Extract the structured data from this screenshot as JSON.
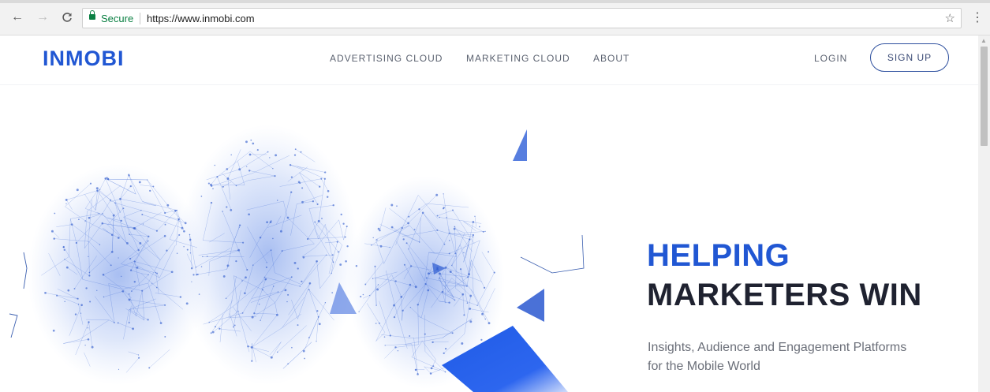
{
  "browser": {
    "back_icon": "arrow-left-icon",
    "forward_icon": "arrow-right-icon",
    "reload_icon": "reload-icon",
    "secure_label": "Secure",
    "url": "https://www.inmobi.com",
    "bookmark_icon": "star-icon",
    "menu_icon": "kebab-menu-icon"
  },
  "site": {
    "logo_text": "INMOBI",
    "brand_color": "#2157d3",
    "nav": [
      {
        "label": "ADVERTISING CLOUD"
      },
      {
        "label": "MARKETING CLOUD"
      },
      {
        "label": "ABOUT"
      }
    ],
    "login_label": "LOGIN",
    "signup_label": "SIGN UP"
  },
  "hero": {
    "title_line1": "HELPING",
    "title_line2": "MARKETERS WIN",
    "subtitle": "Insights, Audience and Engagement Platforms for the Mobile World",
    "accent_color": "#2157d3",
    "dark_color": "#1f2230"
  }
}
